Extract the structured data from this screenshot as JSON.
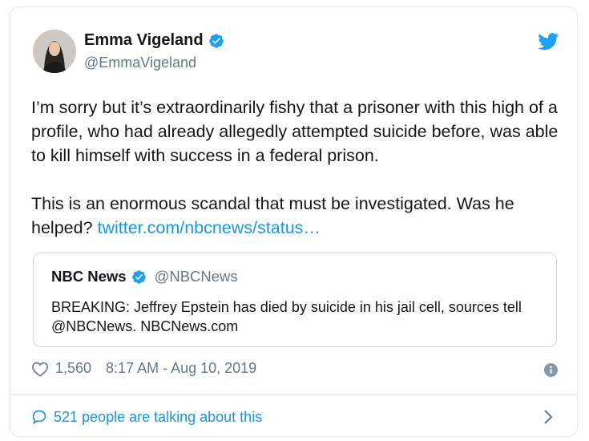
{
  "tweet": {
    "display_name": "Emma Vigeland",
    "handle": "@EmmaVigeland",
    "text_p1": "I’m sorry but it’s extraordinarily fishy that a prisoner with this high of a profile, who had already allegedly attempted suicide before, was able to kill himself with success in a federal prison.",
    "text_p2": "This is an enormous scandal that must be investigated. Was he helped? ",
    "link_text": "twitter.com/nbcnews/status…",
    "likes": "1,560",
    "timestamp": "8:17 AM - Aug 10, 2019",
    "talking": "521 people are talking about this"
  },
  "quoted": {
    "name": "NBC News",
    "handle": "@NBCNews",
    "text": "BREAKING: Jeffrey Epstein has died by suicide in his jail cell, sources tell @NBCNews. NBCNews.com"
  },
  "colors": {
    "accent": "#1b95e0",
    "verified": "#1da1f2",
    "muted": "#657786",
    "border": "#e1e8ed"
  },
  "icons": [
    "verified-badge-icon",
    "twitter-bird-icon",
    "heart-icon",
    "info-icon",
    "speech-bubble-icon",
    "chevron-right-icon"
  ]
}
